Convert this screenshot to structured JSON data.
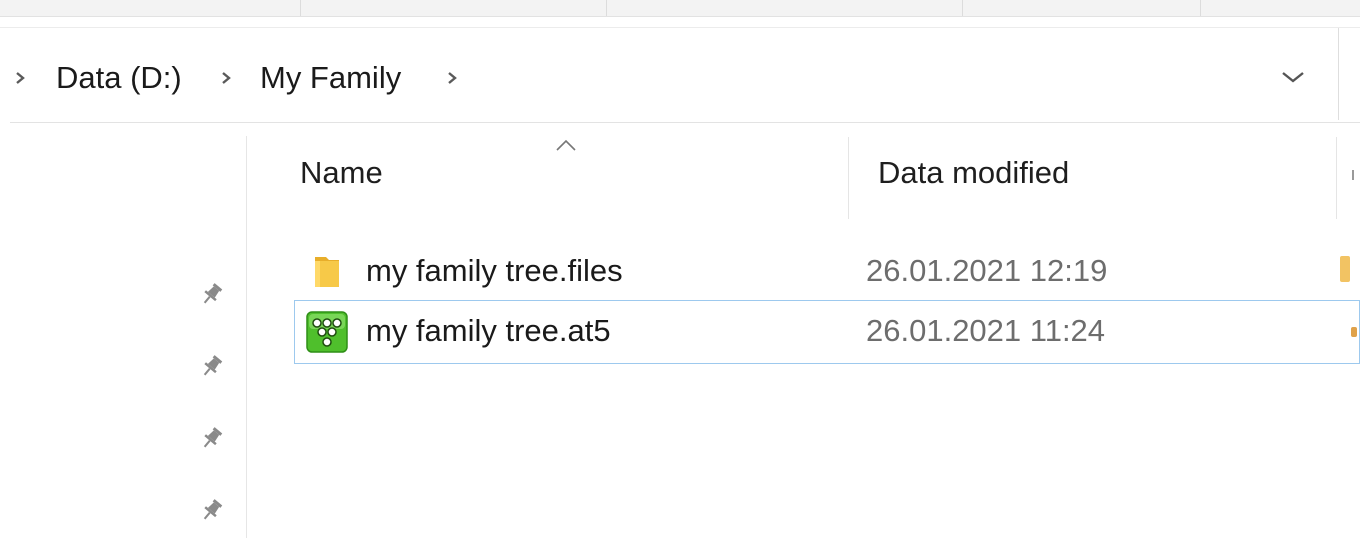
{
  "breadcrumb": {
    "items": [
      {
        "label": "Data (D:)"
      },
      {
        "label": "My Family"
      }
    ]
  },
  "columns": {
    "name": "Name",
    "date_modified": "Data modified"
  },
  "sort": {
    "column": "name",
    "direction": "ascending"
  },
  "files": [
    {
      "name": "my family tree.files",
      "date": "26.01.2021 12:19",
      "icon": "folder-icon",
      "selected": false
    },
    {
      "name": "my family tree.at5",
      "date": "26.01.2021 11:24",
      "icon": "family-tree-app-icon",
      "selected": true
    }
  ],
  "quick_access_pins": 4,
  "colors": {
    "folder": "#f7c948",
    "selection_border": "#9dc9ee",
    "date_text": "#6d6d6d",
    "app_icon": "#4fbf2c"
  }
}
